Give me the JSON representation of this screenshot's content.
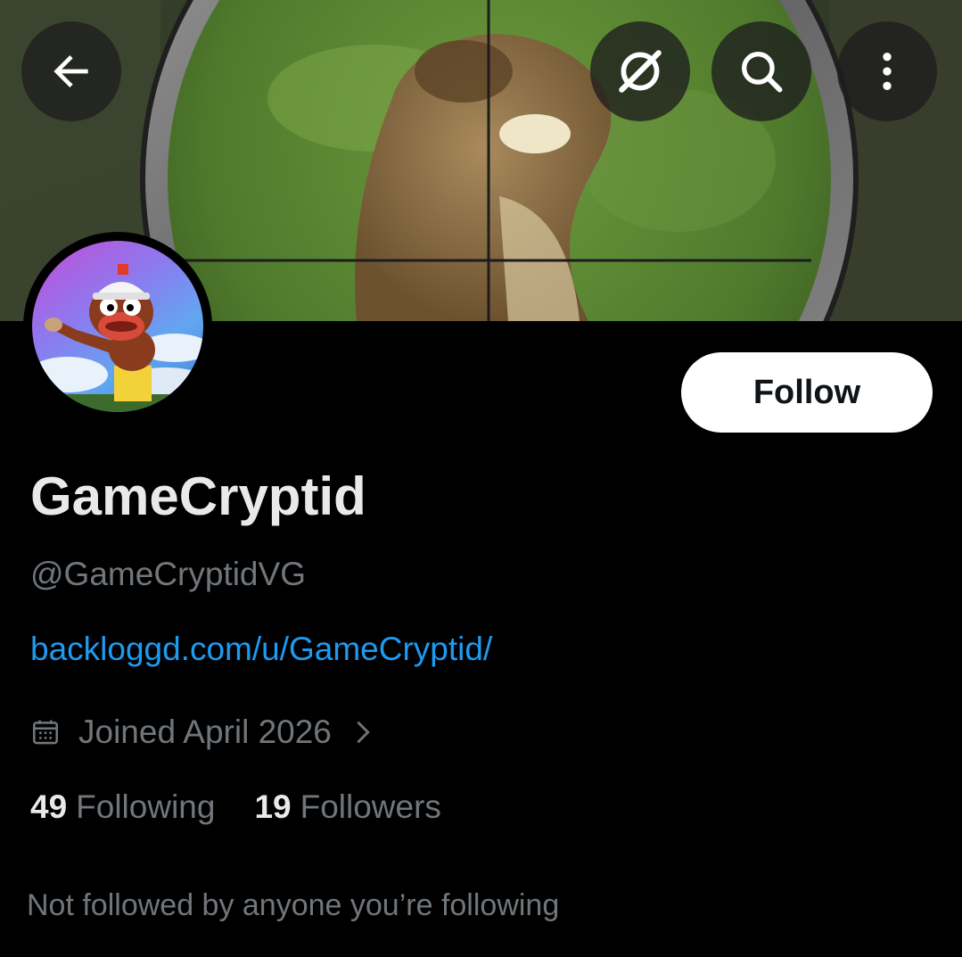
{
  "header": {
    "back_icon": "arrow-left-icon",
    "grok_icon": "grok-icon",
    "search_icon": "search-icon",
    "more_icon": "more-vertical-icon"
  },
  "profile": {
    "display_name": "GameCryptid",
    "handle": "@GameCryptidVG",
    "website": "backloggd.com/u/GameCryptid/",
    "joined": "Joined April 2026",
    "follow_label": "Follow",
    "following_count": "49",
    "following_label": "Following",
    "followers_count": "19",
    "followers_label": "Followers",
    "followed_by_text": "Not followed by anyone you’re following"
  },
  "colors": {
    "background": "#000000",
    "primary_text": "#e7e9ea",
    "secondary_text": "#71767b",
    "link": "#1d9bf0",
    "follow_button_bg": "#ffffff",
    "follow_button_text": "#0f1419"
  }
}
